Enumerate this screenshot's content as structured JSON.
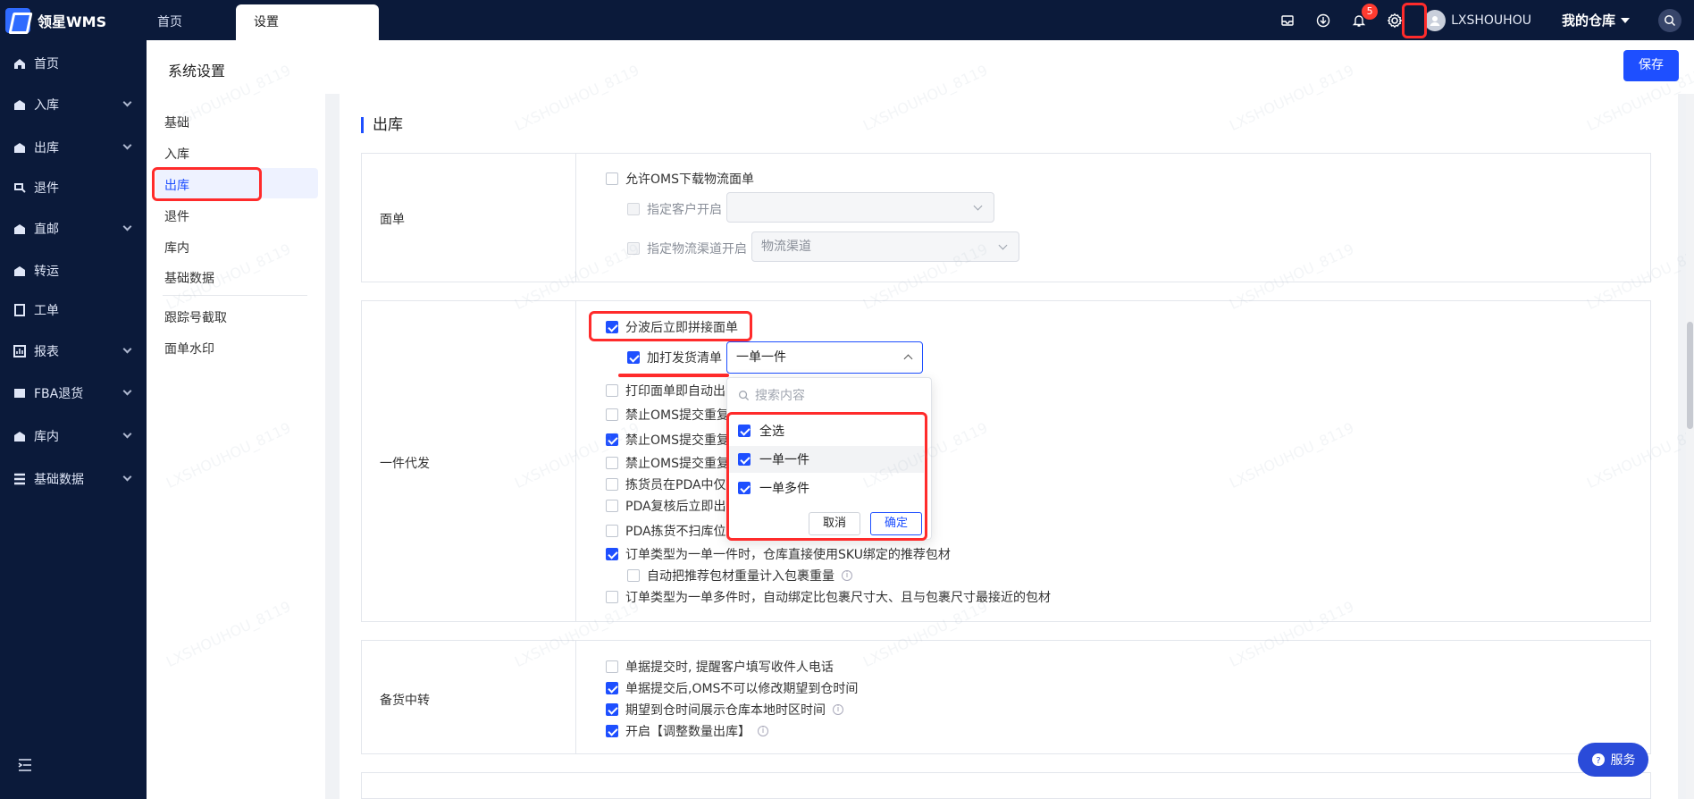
{
  "app": {
    "name": "领星WMS"
  },
  "top_tabs": [
    {
      "label": "首页"
    },
    {
      "label": "设置"
    }
  ],
  "topbar": {
    "notification_count": "5",
    "user_name": "LXSHOUHOU",
    "warehouse_label": "我的仓库"
  },
  "sidebar": {
    "items": [
      {
        "label": "首页",
        "icon": "home-icon"
      },
      {
        "label": "入库",
        "icon": "inbound-icon"
      },
      {
        "label": "出库",
        "icon": "outbound-icon"
      },
      {
        "label": "退件",
        "icon": "return-icon"
      },
      {
        "label": "直邮",
        "icon": "direct-mail-icon"
      },
      {
        "label": "转运",
        "icon": "transfer-icon"
      },
      {
        "label": "工单",
        "icon": "ticket-icon"
      },
      {
        "label": "报表",
        "icon": "report-icon"
      },
      {
        "label": "FBA退货",
        "icon": "fba-return-icon"
      },
      {
        "label": "库内",
        "icon": "inventory-icon"
      },
      {
        "label": "基础数据",
        "icon": "base-data-icon"
      }
    ]
  },
  "page": {
    "title": "系统设置",
    "save_label": "保存"
  },
  "subnav": {
    "items": [
      "基础",
      "入库",
      "出库",
      "退件",
      "库内",
      "基础数据"
    ],
    "extra_items": [
      "跟踪号截取",
      "面单水印"
    ],
    "selected": "出库"
  },
  "section": {
    "title": "出库"
  },
  "miandan": {
    "label": "面单",
    "allow_oms_download": "允许OMS下载物流面单",
    "specify_customer": "指定客户开启",
    "specify_channel": "指定物流渠道开启",
    "channel_placeholder": "物流渠道"
  },
  "yijian": {
    "label": "一件代发",
    "opt_split_stitch": "分波后立即拼接面单",
    "opt_add_packing_list": "加打发货清单",
    "dropdown_value": "一单一件",
    "rows": [
      "打印面单即自动出",
      "禁止OMS提交重复",
      "禁止OMS提交重复",
      "禁止OMS提交重复",
      "拣货员在PDA中仅",
      "PDA复核后立即出",
      "PDA拣货不扫库位"
    ],
    "sku_pack": "订单类型为一单一件时，仓库直接使用SKU绑定的推荐包材",
    "auto_weight": "自动把推荐包材重量计入包裹重量",
    "multi_pack": "订单类型为一单多件时，自动绑定比包裹尺寸大、且与包裹尺寸最接近的包材"
  },
  "popup": {
    "search_placeholder": "搜索内容",
    "options": [
      "全选",
      "一单一件",
      "一单多件"
    ],
    "cancel": "取消",
    "ok": "确定"
  },
  "beihuo": {
    "label": "备货中转",
    "rows": [
      "单据提交时, 提醒客户填写收件人电话",
      "单据提交后,OMS不可以修改期望到仓时间",
      "期望到仓时间展示仓库本地时区时间",
      "开启【调整数量出库】"
    ]
  },
  "service": {
    "label": "服务"
  },
  "watermark_text": "LXSHOUHOU_8119",
  "colors": {
    "sidebar_bg": "#0b1a3a",
    "primary": "#1e4fff",
    "highlight": "#ff2b2b"
  }
}
